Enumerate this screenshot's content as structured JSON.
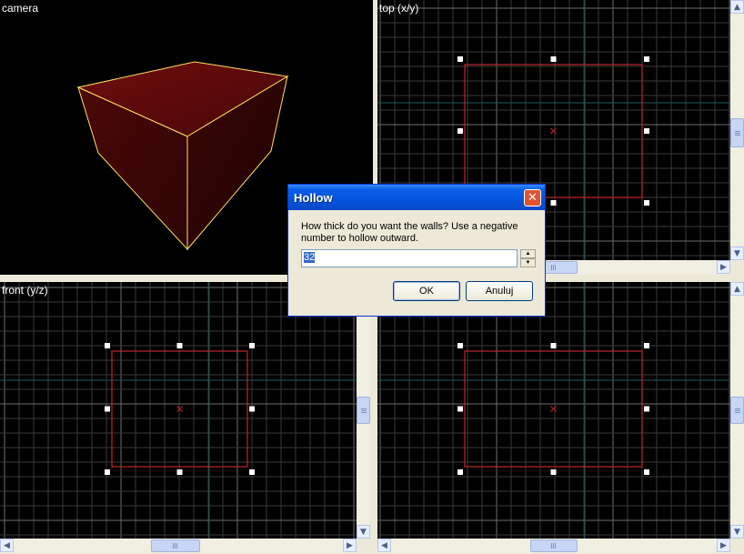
{
  "viewports": {
    "camera": {
      "label": "camera"
    },
    "top": {
      "label": "top (x/y)"
    },
    "front": {
      "label": "front (y/z)"
    },
    "side": {
      "label": ""
    }
  },
  "dialog": {
    "title": "Hollow",
    "close_glyph": "✕",
    "prompt": "How thick do you want the walls? Use a negative number to hollow outward.",
    "value": "32",
    "ok_label": "OK",
    "cancel_label": "Anuluj"
  },
  "colors": {
    "grid_minor": "#3a3a3a",
    "grid_major": "#6e6e6e",
    "axis": "#1f5a5a",
    "brush_outline": "#c0252b",
    "cube_edge": "#ffe060",
    "dialog_title": "#0653dc"
  },
  "icons": {
    "arrow_up": "▲",
    "arrow_down": "▼",
    "arrow_left": "◀",
    "arrow_right": "▶"
  }
}
